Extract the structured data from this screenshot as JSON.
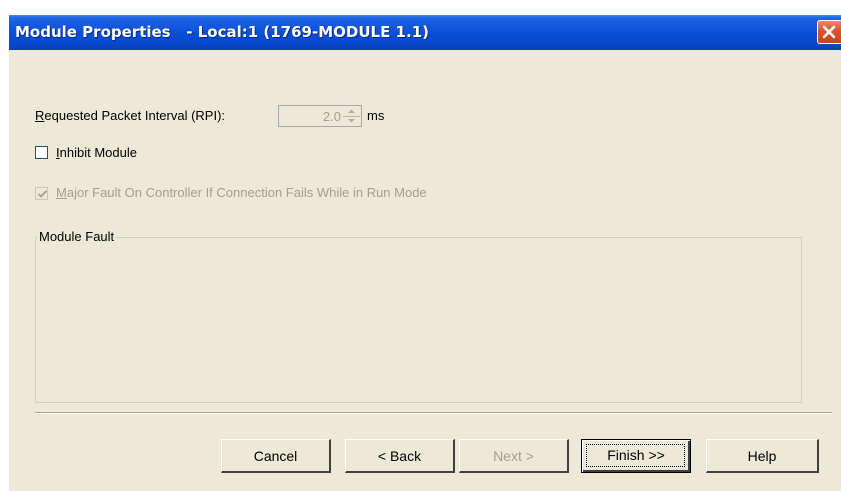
{
  "window": {
    "title": "Module Properties   - Local:1 (1769-MODULE 1.1)"
  },
  "rpi": {
    "label_hotkey": "R",
    "label_rest": "equested Packet Interval (RPI):",
    "value": "2.0",
    "unit": "ms"
  },
  "inhibit": {
    "label_hotkey": "I",
    "label_rest": "nhibit Module",
    "checked": false
  },
  "major_fault": {
    "label_hotkey": "M",
    "label_rest": "ajor Fault On Controller If Connection Fails While in Run Mode",
    "checked": true,
    "enabled": false
  },
  "module_fault": {
    "legend": "Module Fault",
    "text": ""
  },
  "buttons": {
    "cancel": "Cancel",
    "back": "< Back",
    "next": "Next >",
    "finish": "Finish >>",
    "help": "Help"
  },
  "colors": {
    "titlebar": "#0a4fd8",
    "dialog_bg": "#ece9d8",
    "disabled_text": "#a39f90",
    "close_button": "#d9562e"
  },
  "icons": {
    "close": "close-icon",
    "spin_up": "spin-up-arrow-icon",
    "spin_down": "spin-down-arrow-icon",
    "check": "checkmark-icon"
  }
}
